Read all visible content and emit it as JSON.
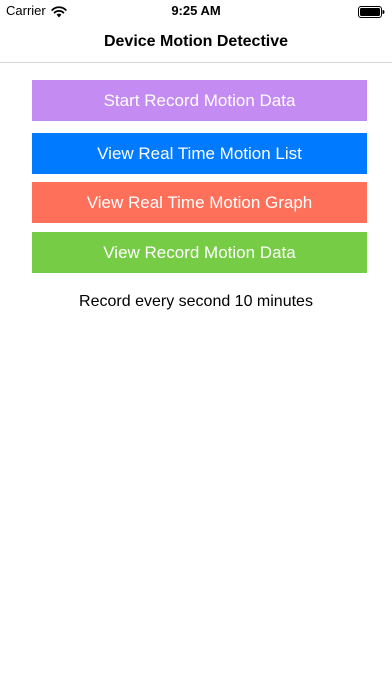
{
  "status_bar": {
    "carrier": "Carrier",
    "time": "9:25 AM",
    "wifi_icon": "wifi-icon",
    "battery_icon": "battery-icon"
  },
  "nav": {
    "title": "Device Motion Detective"
  },
  "buttons": {
    "start_record": {
      "label": "Start Record Motion Data",
      "color": "#c48cf3"
    },
    "realtime_list": {
      "label": "View Real Time Motion List",
      "color": "#007aff"
    },
    "realtime_graph": {
      "label": "View Real Time Motion Graph",
      "color": "#ff705a"
    },
    "record_data": {
      "label": "View Record Motion Data",
      "color": "#76cc44"
    }
  },
  "info": {
    "text": "Record every second 10 minutes"
  },
  "colors": {
    "background": "#ffffff",
    "divider": "#d7d7db",
    "text": "#000000"
  }
}
